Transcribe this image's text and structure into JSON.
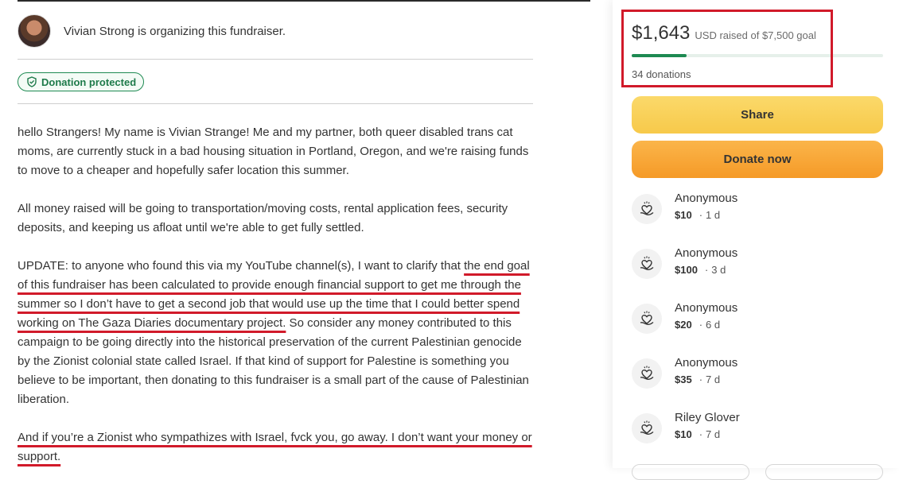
{
  "organizer": {
    "text": "Vivian Strong is organizing this fundraiser."
  },
  "badge": {
    "label": "Donation protected"
  },
  "story": {
    "p1": "hello Strangers! My name is Vivian Strange! Me and my partner, both queer disabled trans cat moms, are currently stuck in a bad housing situation in Portland, Oregon, and we're raising funds to move to a cheaper and hopefully safer location this summer.",
    "p2": "All money raised will be going to transportation/moving costs, rental application fees, security deposits, and keeping us afloat until we're able to get fully settled.",
    "p3_a": "UPDATE: to anyone who found this via my YouTube channel(s), I want to clarify that ",
    "p3_b": "the end goal of this fundraiser has been calculated to provide enough financial support to get me through the summer so I don’t have to get a second job that would use up the time that I could better spend working on The Gaza Diaries documentary project.",
    "p3_c": " So consider any money contributed to this campaign to be going directly into the historical preservation of the current Palestinian genocide by the Zionist colonial state called Israel. If that kind of support for Palestine is something you believe to be important, then donating to this fundraiser is a small part of the cause of Palestinian liberation.",
    "p4": "And if you’re a Zionist who sympathizes with Israel, fvck you, go away. I don’t want your money or support."
  },
  "summary": {
    "amount": "$1,643",
    "goal_text": "USD raised of $7,500 goal",
    "progress_fraction": 0.219,
    "donations_count": "34 donations"
  },
  "buttons": {
    "share": "Share",
    "donate": "Donate now"
  },
  "donations": [
    {
      "name": "Anonymous",
      "amount": "$10",
      "time": "1 d"
    },
    {
      "name": "Anonymous",
      "amount": "$100",
      "time": "3 d"
    },
    {
      "name": "Anonymous",
      "amount": "$20",
      "time": "6 d"
    },
    {
      "name": "Anonymous",
      "amount": "$35",
      "time": "7 d"
    },
    {
      "name": "Riley Glover",
      "amount": "$10",
      "time": "7 d"
    }
  ],
  "icons": {
    "badge": "shield-check-icon",
    "donation": "heart-hand-icon"
  },
  "colors": {
    "accent_green": "#1e8a52",
    "annotation_red": "#d11a2a",
    "share_yellow": "#f7c94a",
    "donate_orange": "#f59a27"
  }
}
